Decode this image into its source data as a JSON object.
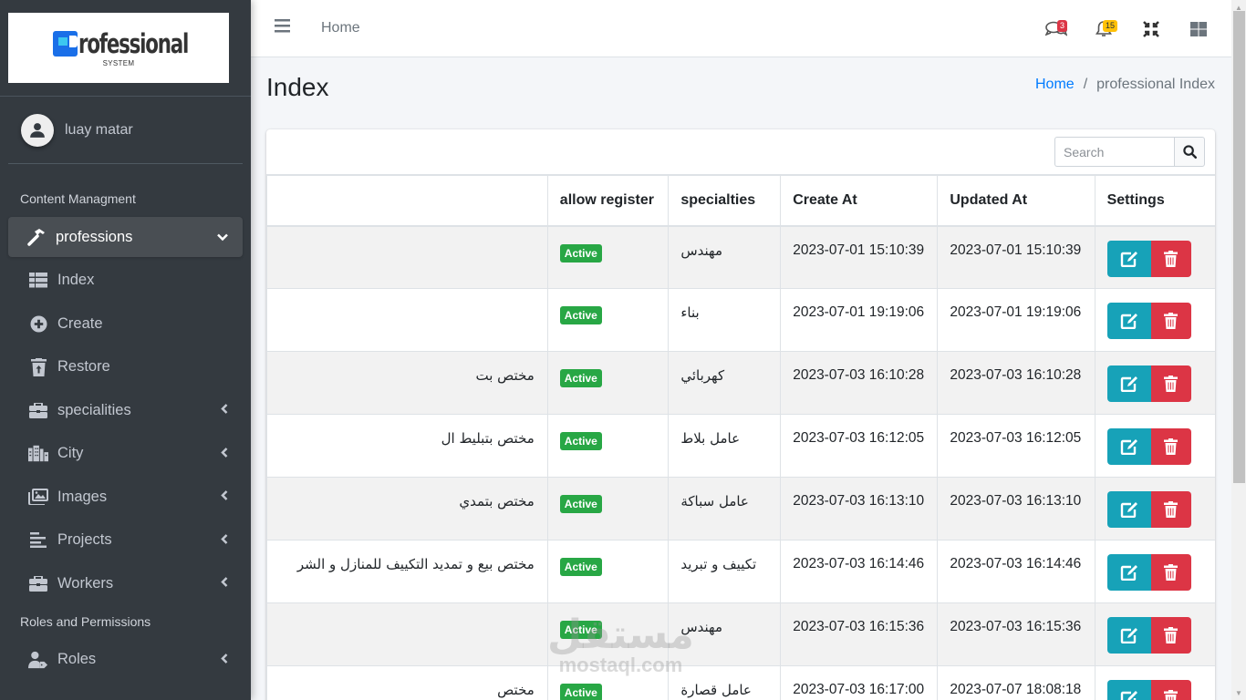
{
  "brand": {
    "name": "rofessional",
    "initial": "P",
    "subtitle": "SYSTEM"
  },
  "user": {
    "name": "luay matar"
  },
  "sidebar": {
    "sections": [
      {
        "header": "Content Managment"
      },
      {
        "header": "Roles and Permissions"
      }
    ],
    "items": [
      {
        "label": "professions",
        "icon": "hammer-icon",
        "active": true,
        "expanded": true
      },
      {
        "label": "Index",
        "icon": "table-list-icon",
        "sub": true
      },
      {
        "label": "Create",
        "icon": "plus-circle-icon",
        "sub": true
      },
      {
        "label": "Restore",
        "icon": "trash-restore-icon",
        "sub": true
      },
      {
        "label": "specialities",
        "icon": "briefcase-icon",
        "has_children": true
      },
      {
        "label": "City",
        "icon": "city-icon",
        "has_children": true
      },
      {
        "label": "Images",
        "icon": "images-icon",
        "has_children": true
      },
      {
        "label": "Projects",
        "icon": "align-left-icon",
        "has_children": true
      },
      {
        "label": "Workers",
        "icon": "briefcase-icon",
        "has_children": true
      },
      {
        "label": "Roles",
        "icon": "user-tag-icon",
        "has_children": true
      }
    ]
  },
  "topbar": {
    "home_label": "Home",
    "messages_count": "3",
    "notifications_count": "15"
  },
  "page": {
    "title": "Index",
    "breadcrumb": [
      {
        "label": "Home",
        "link": true
      },
      {
        "label": "professional Index",
        "link": false
      }
    ]
  },
  "search": {
    "placeholder": "Search",
    "value": ""
  },
  "table": {
    "columns": [
      "",
      "allow register",
      "specialties",
      "Create At",
      "Updated At",
      "Settings"
    ],
    "rows": [
      {
        "name": "",
        "status": "Active",
        "specialty": "مهندس",
        "created": "2023-07-01 15:10:39",
        "updated": "2023-07-01 15:10:39"
      },
      {
        "name": "",
        "status": "Active",
        "specialty": "بناء",
        "created": "2023-07-01 19:19:06",
        "updated": "2023-07-01 19:19:06"
      },
      {
        "name": "مختص بت",
        "status": "Active",
        "specialty": "كهربائي",
        "created": "2023-07-03 16:10:28",
        "updated": "2023-07-03 16:10:28"
      },
      {
        "name": "مختص بتبليط ال",
        "status": "Active",
        "specialty": "عامل بلاط",
        "created": "2023-07-03 16:12:05",
        "updated": "2023-07-03 16:12:05"
      },
      {
        "name": "مختص بتمدي",
        "status": "Active",
        "specialty": "عامل سباكة",
        "created": "2023-07-03 16:13:10",
        "updated": "2023-07-03 16:13:10"
      },
      {
        "name": "مختص بيع و تمديد التكييف للمنازل و الشر",
        "status": "Active",
        "specialty": "تكييف و تبريد",
        "created": "2023-07-03 16:14:46",
        "updated": "2023-07-03 16:14:46"
      },
      {
        "name": "",
        "status": "Active",
        "specialty": "مهندس",
        "created": "2023-07-03 16:15:36",
        "updated": "2023-07-03 16:15:36"
      },
      {
        "name": "مختص",
        "status": "Active",
        "specialty": "عامل قصارة",
        "created": "2023-07-03 16:17:00",
        "updated": "2023-07-07 18:08:18"
      }
    ]
  },
  "watermark": {
    "arabic": "مستقل",
    "latin": "mostaql.com"
  },
  "colors": {
    "sidebar_bg": "#343a40",
    "active_badge": "#28a745",
    "edit_button": "#17a2b8",
    "delete_button": "#dc3545",
    "link": "#007bff"
  }
}
